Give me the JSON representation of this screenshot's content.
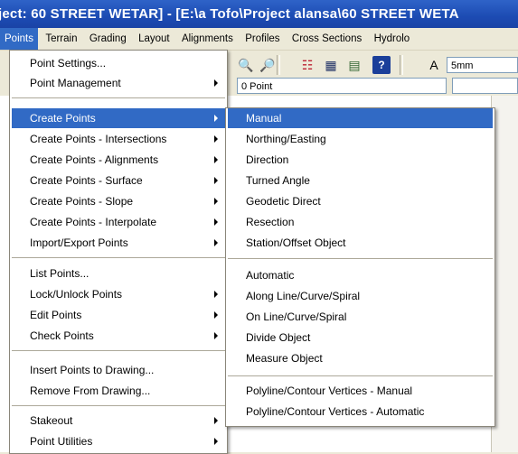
{
  "window": {
    "title": "ject: 60 STREET WETAR] - [E:\\a Tofo\\Project alansa\\60 STREET WETA"
  },
  "menubar": {
    "items": [
      "Points",
      "Terrain",
      "Grading",
      "Layout",
      "Alignments",
      "Profiles",
      "Cross Sections",
      "Hydrolo"
    ],
    "active": "Points"
  },
  "toolbar": {
    "layer_combo": "0 Point",
    "size_combo": "5mm"
  },
  "points_menu": {
    "groups": [
      [
        "Point Settings...",
        "Point Management"
      ],
      [
        "Create Points",
        "Create Points - Intersections",
        "Create Points - Alignments",
        "Create Points - Surface",
        "Create Points - Slope",
        "Create Points - Interpolate",
        "Import/Export Points"
      ],
      [
        "List Points...",
        "Lock/Unlock Points",
        "Edit Points",
        "Check Points"
      ],
      [
        "Insert Points to Drawing...",
        "Remove From Drawing..."
      ],
      [
        "Stakeout",
        "Point Utilities"
      ]
    ]
  },
  "create_points_submenu": {
    "groups": [
      [
        "Manual",
        "Northing/Easting",
        "Direction",
        "Turned Angle",
        "Geodetic Direct",
        "Resection",
        "Station/Offset Object"
      ],
      [
        "Automatic",
        "Along Line/Curve/Spiral",
        "On Line/Curve/Spiral",
        "Divide Object",
        "Measure Object"
      ],
      [
        "Polyline/Contour Vertices - Manual",
        "Polyline/Contour Vertices - Automatic"
      ]
    ]
  }
}
